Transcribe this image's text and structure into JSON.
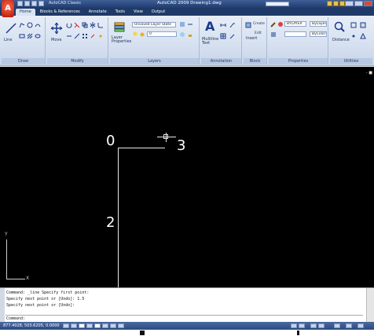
{
  "titlebar": {
    "app_button": "A",
    "qat_title": "AutoCAD Classic",
    "window_title": "AutoCAD 2009 Drawing1.dwg"
  },
  "tabs": [
    "Home",
    "Blocks & References",
    "Annotate",
    "Tools",
    "View",
    "Output"
  ],
  "ribbon": {
    "panels": [
      "Draw",
      "Modify",
      "Layers",
      "Annotation",
      "Block",
      "Properties",
      "Utilities"
    ],
    "draw_tools": [
      "Line"
    ],
    "modify_tools": [
      "Move"
    ],
    "layer_properties_label": "Layer\nProperties",
    "layer_state_combo": "Unsaved Layer State",
    "layer_combo": "0",
    "multiline_text_label": "Multiline\nText",
    "insert_label": "Insert",
    "create_label": "Create",
    "edit_label": "Edit",
    "bylayer_combo": "BYLAYER",
    "bylayer_short": "ByLayer",
    "bycolor_combo": "ByColor",
    "odometer_label": "Distance"
  },
  "canvas": {
    "viewport_label": "- ■",
    "labels": [
      "0",
      "3",
      "2"
    ],
    "ucs_x": "X",
    "ucs_y": "Y"
  },
  "command": {
    "history": [
      "Command: _line Specify first point:",
      "Specify next point or [Undo]: 1.5",
      "Specify next point or [Undo]:"
    ],
    "prompt": "Command:"
  },
  "status": {
    "coordinates": "877.4028, 503.6205, 0.0000"
  },
  "icons": {
    "line": "line-icon",
    "move": "move-icon",
    "layer": "layer-icon",
    "text": "text-icon",
    "zoom": "zoom-icon"
  }
}
